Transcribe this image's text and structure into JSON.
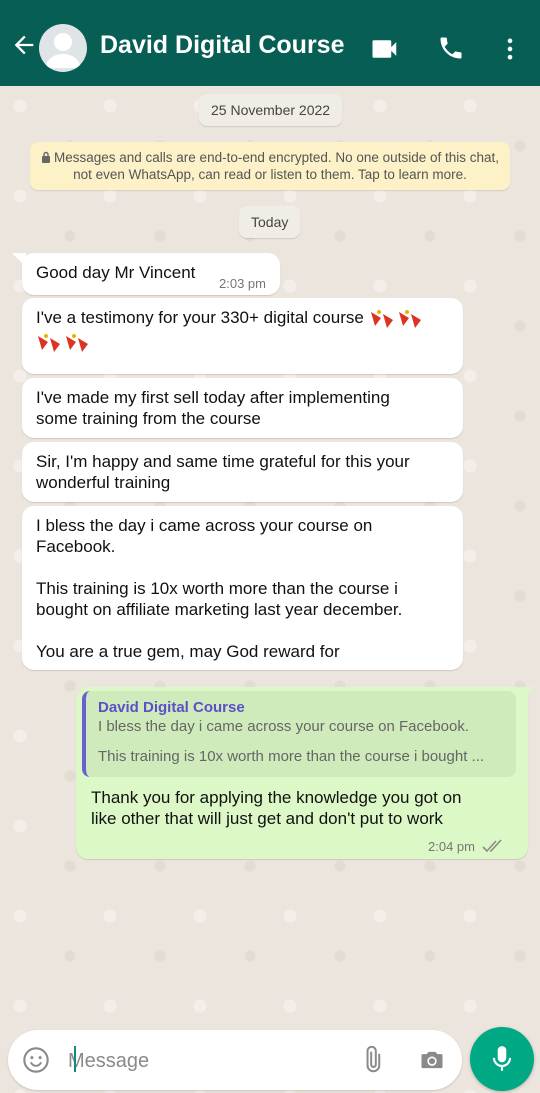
{
  "header": {
    "title": "David Digital Course",
    "icons": [
      "back-arrow-icon",
      "avatar",
      "video-call-icon",
      "phone-icon",
      "more-vert-icon"
    ]
  },
  "chat": {
    "date_chip": "25 November 2022",
    "encryption_notice": "Messages and calls are end-to-end encrypted. No one outside of this chat, not even WhatsApp, can read or listen to them. Tap to learn more.",
    "today_chip": "Today",
    "incoming": [
      {
        "text": "Good day Mr Vincent",
        "time": "2:03 pm"
      },
      {
        "text": "I've a testimony for your 330+ digital course"
      },
      {
        "text": "I've made my first sell today after implementing\nsome training from the course"
      },
      {
        "text": "Sir, I'm happy and same time grateful for this your\nwonderful training"
      },
      {
        "text": "I bless the day i came across your course on\nFacebook.\n\nThis training is 10x worth more than the course i\nbought on affiliate marketing last year december.\n\nYou are a true gem, may God reward for"
      }
    ],
    "outgoing": {
      "quote_name": "David Digital Course",
      "quote_line1": "I bless the day i came across your course on Facebook.",
      "quote_line2": "This training is 10x worth more than the course i bought ...",
      "text": "Thank you for applying the knowledge you got on\nlike other that will just get and don't put to work",
      "time": "2:04 pm",
      "status": "read"
    }
  },
  "composer": {
    "placeholder": "Message"
  },
  "colors": {
    "header": "#075e54",
    "outgoing_bubble": "#dcf8c6",
    "mic_button": "#00a884",
    "quote_accent": "#6b5fd1"
  }
}
